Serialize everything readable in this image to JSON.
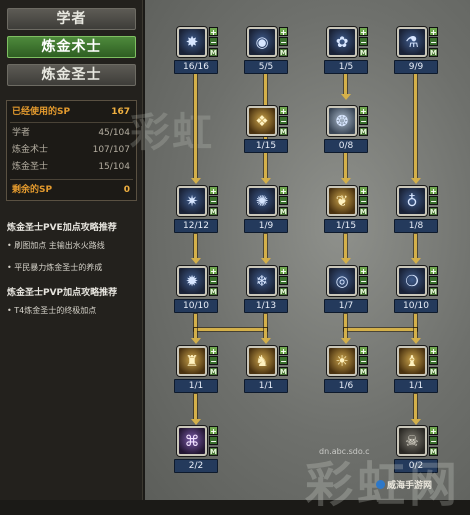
{
  "jobs": [
    "学者",
    "炼金术士",
    "炼金圣士"
  ],
  "sp": {
    "used_label": "已经使用的SP",
    "used_value": "167",
    "rows": [
      {
        "label": "学者",
        "value": "45/104"
      },
      {
        "label": "炼金术士",
        "value": "107/107"
      },
      {
        "label": "炼金圣士",
        "value": "15/104"
      }
    ],
    "remaining_label": "剩余的SP",
    "remaining_value": "0"
  },
  "guides": {
    "pve_title": "炼金圣士PVE加点攻略推荐",
    "pve_items": [
      "• 刷图加点 主输出水火路线",
      "• 平民暴力炼金圣士的养成"
    ],
    "pvp_title": "炼金圣士PVP加点攻略推荐",
    "pvp_items": [
      "• T4炼金圣士的终极加点"
    ]
  },
  "skills": [
    {
      "level": "16/16",
      "icon": "meteor-icon"
    },
    {
      "level": "5/5",
      "icon": "orb-icon"
    },
    {
      "level": "1/5",
      "icon": "rabbit-icon"
    },
    {
      "level": "9/9",
      "icon": "potion-icon"
    },
    {
      "level": "1/15",
      "icon": "beast-icon"
    },
    {
      "level": "0/8",
      "icon": "tornado-icon"
    },
    {
      "level": "12/12",
      "icon": "claw-icon"
    },
    {
      "level": "1/9",
      "icon": "burst-icon"
    },
    {
      "level": "1/15",
      "icon": "butterfly-icon"
    },
    {
      "level": "1/8",
      "icon": "flask-icon"
    },
    {
      "level": "10/10",
      "icon": "flame-orb-icon"
    },
    {
      "level": "1/13",
      "icon": "ice-crystal-icon"
    },
    {
      "level": "1/7",
      "icon": "bubble-icon"
    },
    {
      "level": "10/10",
      "icon": "water-orb-icon"
    },
    {
      "level": "1/1",
      "icon": "gold-bottle-icon"
    },
    {
      "level": "1/1",
      "icon": "gold-bell-icon"
    },
    {
      "level": "1/6",
      "icon": "golem-icon"
    },
    {
      "level": "1/1",
      "icon": "gold-vial-icon"
    },
    {
      "level": "2/2",
      "icon": "rune-icon"
    },
    {
      "level": "0/2",
      "icon": "skull-icon"
    }
  ],
  "controls": {
    "plus": "+",
    "minus": "−",
    "master": "M"
  },
  "watermark": {
    "top": "彩虹",
    "bottom": "彩虹网",
    "url": "dn.abc.sdo.c",
    "site": "威海手游网"
  },
  "colors": {
    "accent_green": "#4e8a3c",
    "sp_orange": "#e39a2e",
    "link_gold": "#d4b04a"
  }
}
